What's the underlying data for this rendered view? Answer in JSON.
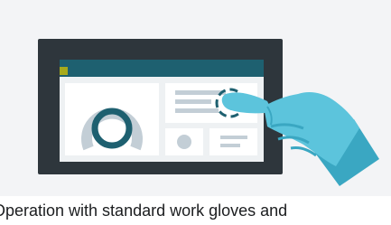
{
  "caption": {
    "text": "Operation with standard work gloves and"
  },
  "colors": {
    "panel_background": "#f3f4f6",
    "device_frame": "#2e363c",
    "title_bar": "#1e6070",
    "title_bar_accent": "#a7aa1b",
    "screen_background": "#eef1f3",
    "widget_background": "#ffffff",
    "widget_lines": "#c3ced6",
    "gauge_ring": "#1e6070",
    "gauge_track": "#c3ced6",
    "glove": "#5cc4dc",
    "glove_shadow": "#3aa7c2",
    "tap_ring": "#1e6070"
  },
  "icons": [
    "touch-panel-device-icon",
    "gauge-icon",
    "gloved-hand-icon",
    "tap-ring-icon"
  ]
}
